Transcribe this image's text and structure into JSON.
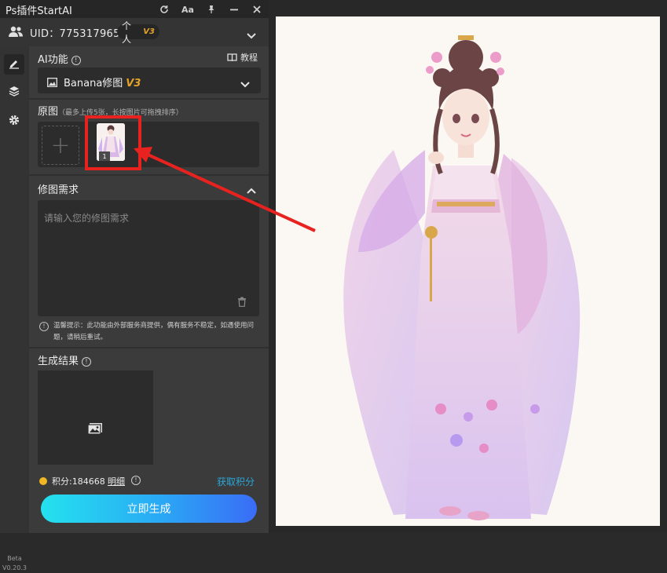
{
  "titlebar": {
    "title": "Ps插件StartAI",
    "icons": [
      "refresh-icon",
      "font-size-icon",
      "pin-icon",
      "minimize-icon",
      "close-icon"
    ],
    "font_label": "Aa"
  },
  "user": {
    "uid": "UID：775317965",
    "plan_label": "个人",
    "plan_version": "V3"
  },
  "sidebar": {
    "items": [
      "edit-icon",
      "layers-icon",
      "settings-icon"
    ],
    "beta_label": "Beta",
    "version": "V0.20.3"
  },
  "ai_function": {
    "label": "AI功能",
    "tutorial_label": "教程",
    "selected": "Banana修图",
    "selected_version": "V3"
  },
  "source_image": {
    "label": "原图",
    "hint": "（最多上传5张，长按图片可拖拽排序）",
    "thumb_index": "1"
  },
  "edit_request": {
    "label": "修图需求",
    "placeholder": "请输入您的修图需求",
    "notice": "温馨提示：此功能由外部服务商提供，偶有服务不稳定，如遇使用问题，请稍后重试。"
  },
  "result": {
    "label": "生成结果"
  },
  "footer": {
    "points": "积分:184668",
    "detail_label": "明细",
    "get_points_label": "获取积分",
    "generate_label": "立即生成"
  },
  "colors": {
    "accent_gold": "#e3a22a",
    "highlight_red": "#e8221e",
    "link_blue": "#2aa7d8",
    "button_gradient_start": "#24e2ee",
    "button_gradient_end": "#3a6cf6"
  }
}
